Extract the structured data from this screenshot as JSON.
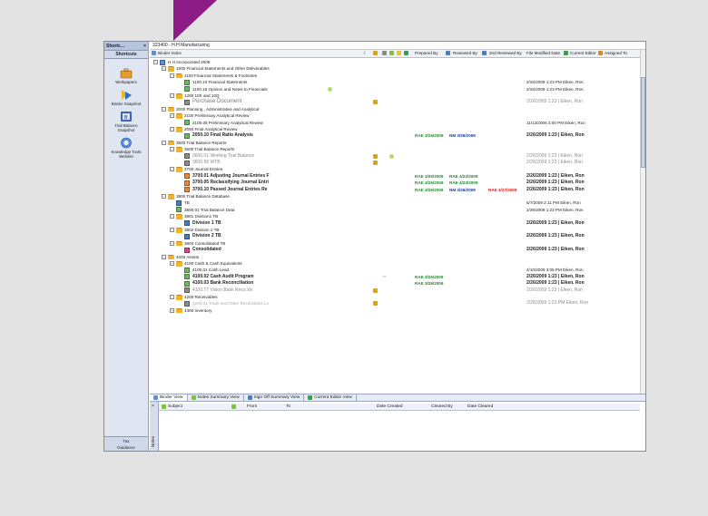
{
  "sidebar": {
    "header_title": "Shortc...",
    "close_label": "×",
    "section_title": "Shortcuts",
    "items": [
      {
        "label": "Workpapers",
        "icon": "briefcase-icon"
      },
      {
        "label": "Binder Snapshot",
        "icon": "binder-snapshot-icon"
      },
      {
        "label": "Trial Balance Snapshot",
        "icon": "trial-balance-icon"
      },
      {
        "label": "Knowledge Tools Website",
        "icon": "knowledge-tools-icon"
      }
    ],
    "bottom_label": "Tax Guidance"
  },
  "window": {
    "title": "323400 - H.H Manufacturing"
  },
  "columns": {
    "binder_index": "Binder Index",
    "slash": "/",
    "prepared_by": "Prepared By",
    "reviewed_by": "Reviewed By",
    "second_reviewed_by": "2nd Reviewed By",
    "file_modified_date": "File Modified Date",
    "current_editor": "Current Editor",
    "assigned_to": "Assigned To"
  },
  "tree": [
    {
      "indent": 0,
      "exp": "−",
      "icon": "root",
      "label": "H.H Incorporated 2008"
    },
    {
      "indent": 1,
      "exp": "−",
      "icon": "folder",
      "label": "1000 Financial Statements and Other Deliverables"
    },
    {
      "indent": 2,
      "exp": "−",
      "icon": "folder",
      "label": "1100 Financial Statements & Footnotes"
    },
    {
      "indent": 3,
      "icon": "doc-green",
      "label": "1100.10 Financial Statements",
      "date": "2/26/2009 1:23 PM  Eiken, Ron"
    },
    {
      "indent": 3,
      "icon": "doc-green",
      "label": "1100.15 Opinion and Notes to Financials",
      "note": true,
      "date": "2/26/2009 1:23 PM  Eiken, Ron"
    },
    {
      "indent": 2,
      "exp": "−",
      "icon": "folder",
      "label": "1200 10K and 10Q"
    },
    {
      "indent": 3,
      "icon": "doc-grey",
      "label": "Purchase Document",
      "style": "greybig",
      "lock": true,
      "date": "2/26/2009 1:23 | Eiken, Ron",
      "dstyle": "grey"
    },
    {
      "indent": 1,
      "exp": "−",
      "icon": "folder",
      "label": "2000 Planning , Administrative and Analytical"
    },
    {
      "indent": 2,
      "exp": "−",
      "icon": "folder",
      "label": "2100 Preliminary Analytical Review"
    },
    {
      "indent": 3,
      "icon": "doc-green",
      "label": "2100.05 Preliminary Analytical Review",
      "date": "11/13/2006 3:00 PM Eiken, Ron"
    },
    {
      "indent": 2,
      "exp": "−",
      "icon": "folder",
      "label": "2050 Final Analytical Review"
    },
    {
      "indent": 3,
      "icon": "doc-green",
      "label": "2050.10 Final Ratio Analysis",
      "style": "bold",
      "prep": "RAE 3/26/2009",
      "rev": "NM 3/26/2009",
      "date": "2/26/2009 1:23 | Eiken, Ron",
      "dstyle": "bold"
    },
    {
      "indent": 1,
      "exp": "−",
      "icon": "folder",
      "label": "3500 Trial Balance Reports"
    },
    {
      "indent": 2,
      "exp": "−",
      "icon": "folder",
      "label": "3600 Trial Balance Reports"
    },
    {
      "indent": 3,
      "icon": "doc-grey",
      "label": "3600.01 Working Trial Balance",
      "style": "grey",
      "lock": true,
      "note": true,
      "date": "2/26/2009 1:23 | Eiken, Ron",
      "dstyle": "grey"
    },
    {
      "indent": 3,
      "icon": "doc-grey",
      "label": "3600.99 WTB",
      "style": "grey",
      "lock": true,
      "date": "2/26/2009 1:23 | Eiken, Ron",
      "dstyle": "grey"
    },
    {
      "indent": 2,
      "exp": "−",
      "icon": "folder",
      "label": "3700 Journal Entries"
    },
    {
      "indent": 3,
      "icon": "doc-orange",
      "label": "3700.01 Adjusting Journal Entries F",
      "style": "bold",
      "prep": "RAE 3/26/2009",
      "rev": "RAE 4/23/2009",
      "date": "2/26/2009 1:23 | Eiken, Ron",
      "dstyle": "bold",
      "rev_color": "green"
    },
    {
      "indent": 3,
      "icon": "doc-orange",
      "label": "3700.05 Reclassifying Journal Entri",
      "style": "bold",
      "prep": "RAE 3/26/2009",
      "rev": "RAE 4/23/2009",
      "date": "2/26/2009 1:23 | Eiken, Ron",
      "dstyle": "bold",
      "rev_color": "green"
    },
    {
      "indent": 3,
      "icon": "doc-orange",
      "label": "3700.10 Passed Journal Entries Re",
      "style": "bold",
      "prep": "RAE 3/26/2009",
      "rev": "NM 3/26/2009",
      "rev2": "RAE 3/27/2009",
      "date": "2/26/2009 1:23 | Eiken, Ron",
      "dstyle": "bold"
    },
    {
      "indent": 1,
      "exp": "−",
      "icon": "folder",
      "label": "3800 Trial Balance Database"
    },
    {
      "indent": 2,
      "icon": "doc-blue",
      "label": "TB",
      "date": "5/7/2009 2:11 PM  Eiken, Ron"
    },
    {
      "indent": 2,
      "icon": "doc-green",
      "label": "3800.01 Trial Balance Data",
      "date": "2/26/2009 1:23 PM  Eiken, Ron"
    },
    {
      "indent": 2,
      "exp": "−",
      "icon": "folder",
      "label": "3801 Division1 TB"
    },
    {
      "indent": 3,
      "icon": "doc-blue",
      "label": "Division 1 TB",
      "style": "bold",
      "date": "2/26/2009 1:23 | Eiken, Ron",
      "dstyle": "bold"
    },
    {
      "indent": 2,
      "exp": "−",
      "icon": "folder",
      "label": "3802 Division 2 TB"
    },
    {
      "indent": 3,
      "icon": "doc-blue",
      "label": "Division 2 TB",
      "style": "bold",
      "date": "2/26/2009 1:23 | Eiken, Ron",
      "dstyle": "bold"
    },
    {
      "indent": 2,
      "exp": "−",
      "icon": "folder",
      "label": "3803 Consolidated TB"
    },
    {
      "indent": 3,
      "icon": "doc-pink",
      "label": "Consolidated",
      "style": "bold",
      "date": "2/26/2009 1:23 | Eiken, Ron",
      "dstyle": "bold"
    },
    {
      "indent": 1,
      "exp": "−",
      "icon": "folder",
      "label": "4000 Assets"
    },
    {
      "indent": 2,
      "exp": "−",
      "icon": "folder",
      "label": "4100 Cash & Cash Equivalents"
    },
    {
      "indent": 3,
      "icon": "doc-green",
      "label": "4100.01 Cash Lead",
      "date": "4/10/2009 3:05 PM Eiken, Ron"
    },
    {
      "indent": 3,
      "icon": "doc-green",
      "label": "4100.02 Cash Audit Program",
      "style": "bold",
      "link": true,
      "prep": "RAE 3/26/2009",
      "date": "2/26/2009 1:23 | Eiken, Ron",
      "dstyle": "bold"
    },
    {
      "indent": 3,
      "icon": "doc-green",
      "label": "4100.03 Bank Reconciliation",
      "style": "bold",
      "prep": "RAE 3/26/2009",
      "date": "2/26/2009 1:23 | Eiken, Ron",
      "dstyle": "bold"
    },
    {
      "indent": 3,
      "icon": "doc-grey",
      "label": "4100.77 Vision Bank Recs.xls",
      "style": "grey",
      "lock": true,
      "date": "2/26/2009 1:23 | Eiken, Ron",
      "dstyle": "grey"
    },
    {
      "indent": 2,
      "exp": "−",
      "icon": "folder",
      "label": "4200 Receivables"
    },
    {
      "indent": 3,
      "icon": "doc-grey",
      "label": "4200.01 Trade and Other Receivables Le",
      "style": "lightgrey",
      "lock": true,
      "date": "2/26/2009 1:23 PM Eiken, Ron",
      "dstyle": "grey"
    },
    {
      "indent": 2,
      "exp": "+",
      "icon": "folder",
      "label": "4300 Inventory"
    }
  ],
  "tabs": [
    {
      "label": "Binder View",
      "active": true
    },
    {
      "label": "Notes Summary View"
    },
    {
      "label": "Sign Off Summary View"
    },
    {
      "label": "Current Editor View"
    }
  ],
  "notes": {
    "side_label": "Notes",
    "close_label": "×",
    "cols": [
      "Subject",
      "From",
      "To",
      "Date Created",
      "Cleared By",
      "Date Cleared"
    ]
  },
  "colors": {
    "accent": "#8d1c86",
    "prepared": "#1f8a2a",
    "reviewed": "#1a3a9c",
    "second_reviewed": "#d02020"
  }
}
